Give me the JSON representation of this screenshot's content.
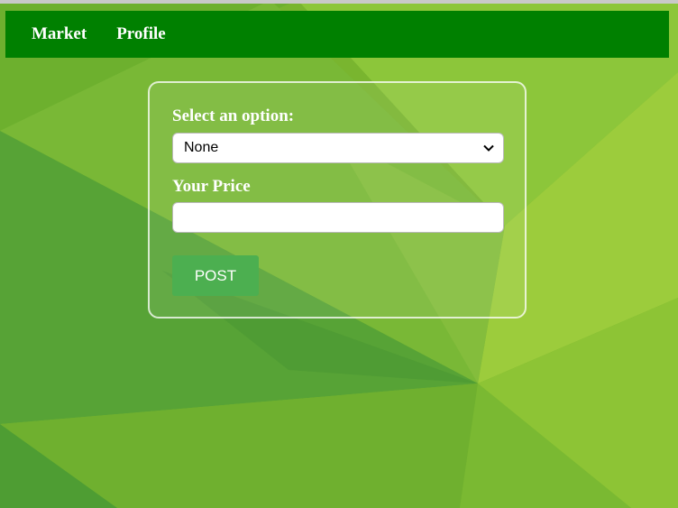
{
  "nav": {
    "items": [
      {
        "label": "Market"
      },
      {
        "label": "Profile"
      }
    ]
  },
  "form": {
    "option_label": "Select an option:",
    "option_selected": "None",
    "price_label": "Your Price",
    "price_value": "",
    "post_label": "POST"
  },
  "colors": {
    "navbar": "#008000",
    "button": "#4caf50",
    "background": "#7cb82f"
  }
}
